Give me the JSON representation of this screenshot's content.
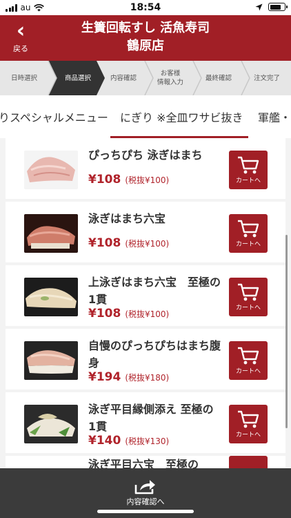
{
  "status_bar": {
    "carrier": "au",
    "time": "18:54"
  },
  "header": {
    "back_label": "戻る",
    "title_line1": "生簀回転すし 活魚寿司",
    "title_line2": "鶴原店"
  },
  "steps": [
    {
      "label": "日時選択",
      "active": false
    },
    {
      "label": "商品選択",
      "active": true
    },
    {
      "label": "内容確認",
      "active": false
    },
    {
      "label": "お客様\n情報入力",
      "active": false
    },
    {
      "label": "最終確認",
      "active": false
    },
    {
      "label": "注文完了",
      "active": false
    }
  ],
  "tabs": [
    {
      "label": "りスペシャルメニュー",
      "active": false
    },
    {
      "label": "にぎり ※全皿ワサビ抜き",
      "active": true
    },
    {
      "label": "軍艦・",
      "active": false
    }
  ],
  "items": [
    {
      "name": "ぴっちぴち 泳ぎはまち",
      "price": "¥108",
      "tax": "(税抜¥100)",
      "cart_label": "カートへ"
    },
    {
      "name": "泳ぎはまち六宝",
      "price": "¥108",
      "tax": "(税抜¥100)",
      "cart_label": "カートへ"
    },
    {
      "name": "上泳ぎはまち六宝　至極の1貫",
      "price": "¥108",
      "tax": "(税抜¥100)",
      "cart_label": "カートへ"
    },
    {
      "name": "自慢のぴっちぴちはまち腹身",
      "price": "¥194",
      "tax": "(税抜¥180)",
      "cart_label": "カートへ"
    },
    {
      "name": "泳ぎ平目縁側添え 至極の1貫",
      "price": "¥140",
      "tax": "(税抜¥130)",
      "cart_label": "カートへ"
    },
    {
      "name": "泳ぎ平目六宝　至極の",
      "price": "",
      "tax": "",
      "cart_label": ""
    }
  ],
  "bottom": {
    "label": "内容確認へ"
  },
  "colors": {
    "brand": "#a11f26",
    "price": "#b0232b",
    "bottom_bar": "#3b3b3b"
  }
}
